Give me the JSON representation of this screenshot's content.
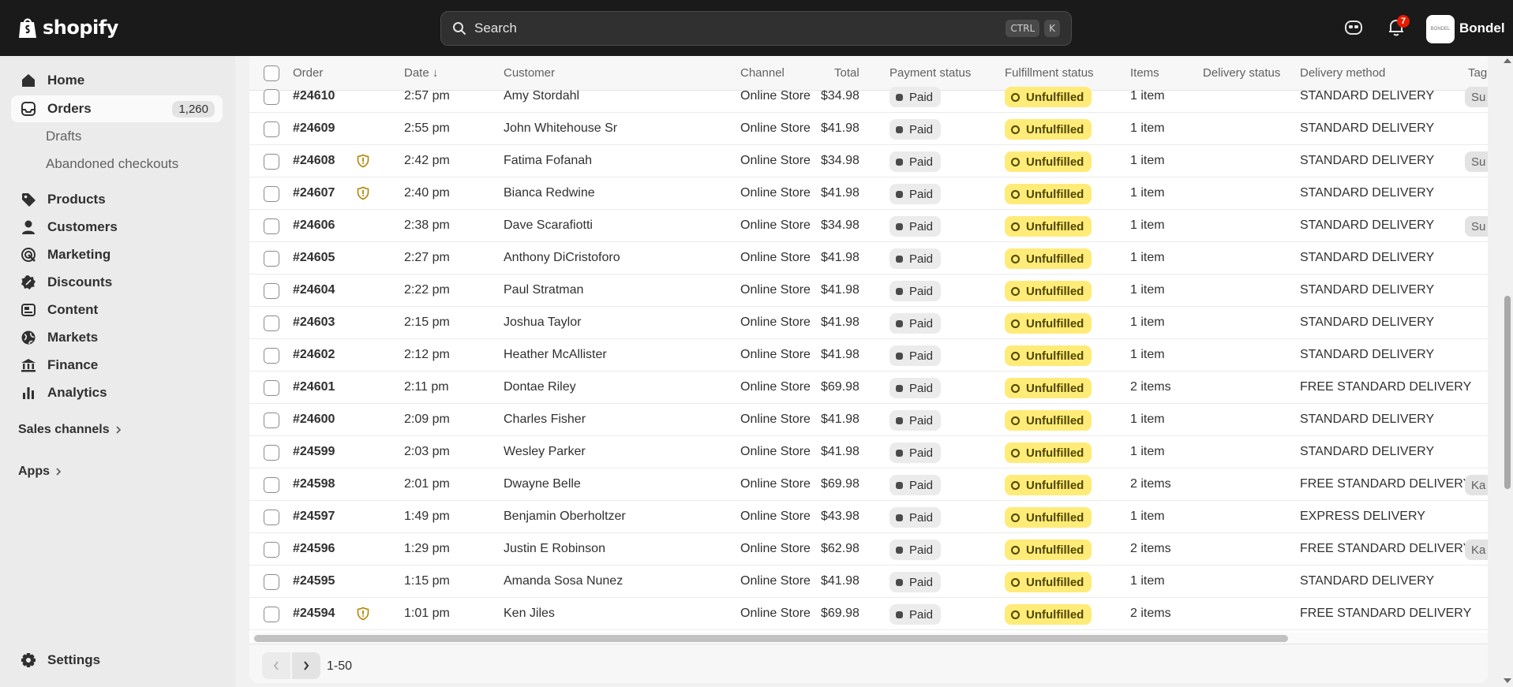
{
  "app": {
    "logo_text": "shopify",
    "store_name": "Bondel",
    "store_avatar_text": "BONDEL",
    "notifications_count": "7"
  },
  "search": {
    "placeholder": "Search",
    "kbd_1": "CTRL",
    "kbd_2": "K"
  },
  "sidebar": {
    "home": "Home",
    "orders": "Orders",
    "orders_count": "1,260",
    "drafts": "Drafts",
    "abandoned": "Abandoned checkouts",
    "products": "Products",
    "customers": "Customers",
    "marketing": "Marketing",
    "discounts": "Discounts",
    "content": "Content",
    "markets": "Markets",
    "finance": "Finance",
    "analytics": "Analytics",
    "sales_channels": "Sales channels",
    "apps": "Apps",
    "settings": "Settings"
  },
  "table": {
    "headers": [
      "Order",
      "Date ↓",
      "Customer",
      "Channel",
      "Total",
      "Payment status",
      "Fulfillment status",
      "Items",
      "Delivery status",
      "Delivery method",
      "Tag"
    ],
    "rows": [
      {
        "order": "#24610",
        "date": "2:57 pm",
        "customer": "Amy Stordahl",
        "channel": "Online Store",
        "total": "$34.98",
        "payment": "Paid",
        "fulfillment": "Unfulfilled",
        "items": "1 item",
        "method": "STANDARD DELIVERY",
        "tag": "Su",
        "warn": false
      },
      {
        "order": "#24609",
        "date": "2:55 pm",
        "customer": "John Whitehouse Sr",
        "channel": "Online Store",
        "total": "$41.98",
        "payment": "Paid",
        "fulfillment": "Unfulfilled",
        "items": "1 item",
        "method": "STANDARD DELIVERY",
        "tag": "",
        "warn": false
      },
      {
        "order": "#24608",
        "date": "2:42 pm",
        "customer": "Fatima Fofanah",
        "channel": "Online Store",
        "total": "$34.98",
        "payment": "Paid",
        "fulfillment": "Unfulfilled",
        "items": "1 item",
        "method": "STANDARD DELIVERY",
        "tag": "Su",
        "warn": true
      },
      {
        "order": "#24607",
        "date": "2:40 pm",
        "customer": "Bianca Redwine",
        "channel": "Online Store",
        "total": "$41.98",
        "payment": "Paid",
        "fulfillment": "Unfulfilled",
        "items": "1 item",
        "method": "STANDARD DELIVERY",
        "tag": "",
        "warn": true
      },
      {
        "order": "#24606",
        "date": "2:38 pm",
        "customer": "Dave Scarafiotti",
        "channel": "Online Store",
        "total": "$34.98",
        "payment": "Paid",
        "fulfillment": "Unfulfilled",
        "items": "1 item",
        "method": "STANDARD DELIVERY",
        "tag": "Su",
        "warn": false
      },
      {
        "order": "#24605",
        "date": "2:27 pm",
        "customer": "Anthony DiCristoforo",
        "channel": "Online Store",
        "total": "$41.98",
        "payment": "Paid",
        "fulfillment": "Unfulfilled",
        "items": "1 item",
        "method": "STANDARD DELIVERY",
        "tag": "",
        "warn": false
      },
      {
        "order": "#24604",
        "date": "2:22 pm",
        "customer": "Paul Stratman",
        "channel": "Online Store",
        "total": "$41.98",
        "payment": "Paid",
        "fulfillment": "Unfulfilled",
        "items": "1 item",
        "method": "STANDARD DELIVERY",
        "tag": "",
        "warn": false
      },
      {
        "order": "#24603",
        "date": "2:15 pm",
        "customer": "Joshua Taylor",
        "channel": "Online Store",
        "total": "$41.98",
        "payment": "Paid",
        "fulfillment": "Unfulfilled",
        "items": "1 item",
        "method": "STANDARD DELIVERY",
        "tag": "",
        "warn": false
      },
      {
        "order": "#24602",
        "date": "2:12 pm",
        "customer": "Heather McAllister",
        "channel": "Online Store",
        "total": "$41.98",
        "payment": "Paid",
        "fulfillment": "Unfulfilled",
        "items": "1 item",
        "method": "STANDARD DELIVERY",
        "tag": "",
        "warn": false
      },
      {
        "order": "#24601",
        "date": "2:11 pm",
        "customer": "Dontae Riley",
        "channel": "Online Store",
        "total": "$69.98",
        "payment": "Paid",
        "fulfillment": "Unfulfilled",
        "items": "2 items",
        "method": "FREE STANDARD DELIVERY",
        "tag": "",
        "warn": false
      },
      {
        "order": "#24600",
        "date": "2:09 pm",
        "customer": "Charles Fisher",
        "channel": "Online Store",
        "total": "$41.98",
        "payment": "Paid",
        "fulfillment": "Unfulfilled",
        "items": "1 item",
        "method": "STANDARD DELIVERY",
        "tag": "",
        "warn": false
      },
      {
        "order": "#24599",
        "date": "2:03 pm",
        "customer": "Wesley Parker",
        "channel": "Online Store",
        "total": "$41.98",
        "payment": "Paid",
        "fulfillment": "Unfulfilled",
        "items": "1 item",
        "method": "STANDARD DELIVERY",
        "tag": "",
        "warn": false
      },
      {
        "order": "#24598",
        "date": "2:01 pm",
        "customer": "Dwayne Belle",
        "channel": "Online Store",
        "total": "$69.98",
        "payment": "Paid",
        "fulfillment": "Unfulfilled",
        "items": "2 items",
        "method": "FREE STANDARD DELIVERY",
        "tag": "Ka",
        "warn": false
      },
      {
        "order": "#24597",
        "date": "1:49 pm",
        "customer": "Benjamin Oberholtzer",
        "channel": "Online Store",
        "total": "$43.98",
        "payment": "Paid",
        "fulfillment": "Unfulfilled",
        "items": "1 item",
        "method": "EXPRESS DELIVERY",
        "tag": "",
        "warn": false
      },
      {
        "order": "#24596",
        "date": "1:29 pm",
        "customer": "Justin E Robinson",
        "channel": "Online Store",
        "total": "$62.98",
        "payment": "Paid",
        "fulfillment": "Unfulfilled",
        "items": "2 items",
        "method": "FREE STANDARD DELIVERY",
        "tag": "Ka",
        "warn": false
      },
      {
        "order": "#24595",
        "date": "1:15 pm",
        "customer": "Amanda Sosa Nunez",
        "channel": "Online Store",
        "total": "$41.98",
        "payment": "Paid",
        "fulfillment": "Unfulfilled",
        "items": "1 item",
        "method": "STANDARD DELIVERY",
        "tag": "",
        "warn": false
      },
      {
        "order": "#24594",
        "date": "1:01 pm",
        "customer": "Ken Jiles",
        "channel": "Online Store",
        "total": "$69.98",
        "payment": "Paid",
        "fulfillment": "Unfulfilled",
        "items": "2 items",
        "method": "FREE STANDARD DELIVERY",
        "tag": "",
        "warn": true
      }
    ]
  },
  "pagination": {
    "range": "1-50"
  },
  "colors": {
    "topbar": "#1a1a1a",
    "unfulfilled_bg": "#ffeb78",
    "paid_bg": "#ebebeb",
    "warning": "#b28500"
  }
}
